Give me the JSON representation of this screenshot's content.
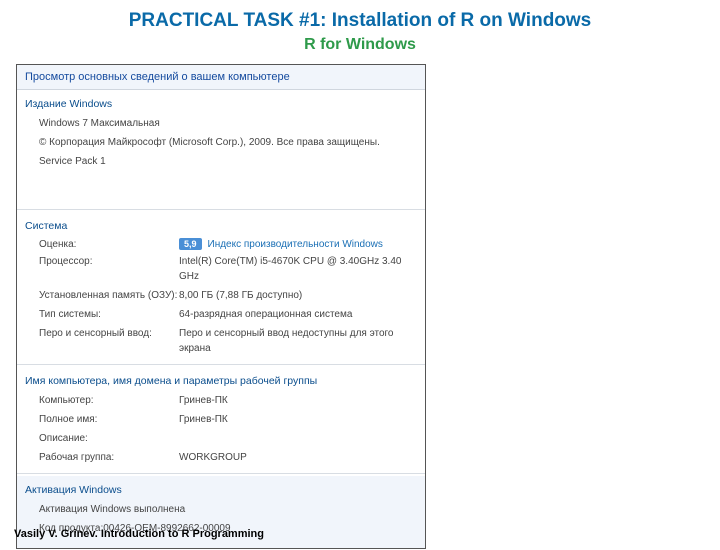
{
  "slide": {
    "title": "PRACTICAL TASK #1: Installation of R on Windows",
    "subtitle": "R for Windows",
    "footer": "Vasily V. Grinev. Introduction to R Programming"
  },
  "panel": {
    "header": "Просмотр основных сведений о вашем компьютере",
    "edition": {
      "title": "Издание Windows",
      "name": "Windows 7 Максимальная",
      "copyright": "© Корпорация Майкрософт (Microsoft Corp.), 2009. Все права защищены.",
      "servicepack": "Service Pack 1"
    },
    "system": {
      "title": "Система",
      "rating_label": "Оценка:",
      "rating_value": "5,9",
      "rating_link": "Индекс производительности Windows",
      "rows": [
        {
          "label": "Процессор:",
          "value": "Intel(R) Core(TM) i5-4670K CPU @ 3.40GHz   3.40 GHz"
        },
        {
          "label": "Установленная память (ОЗУ):",
          "value": "8,00 ГБ (7,88 ГБ доступно)"
        },
        {
          "label": "Тип системы:",
          "value": "64-разрядная операционная система"
        },
        {
          "label": "Перо и сенсорный ввод:",
          "value": "Перо и сенсорный ввод недоступны для этого экрана"
        }
      ]
    },
    "computer": {
      "title": "Имя компьютера, имя домена и параметры рабочей группы",
      "rows": [
        {
          "label": "Компьютер:",
          "value": "Гринев-ПК"
        },
        {
          "label": "Полное имя:",
          "value": "Гринев-ПК"
        },
        {
          "label": "Описание:",
          "value": ""
        },
        {
          "label": "Рабочая группа:",
          "value": "WORKGROUP"
        }
      ]
    },
    "activation": {
      "title": "Активация Windows",
      "status": "Активация Windows выполнена",
      "product_label": "Код продукта: ",
      "product_value": "00426-OEM-8992662-00009"
    }
  }
}
